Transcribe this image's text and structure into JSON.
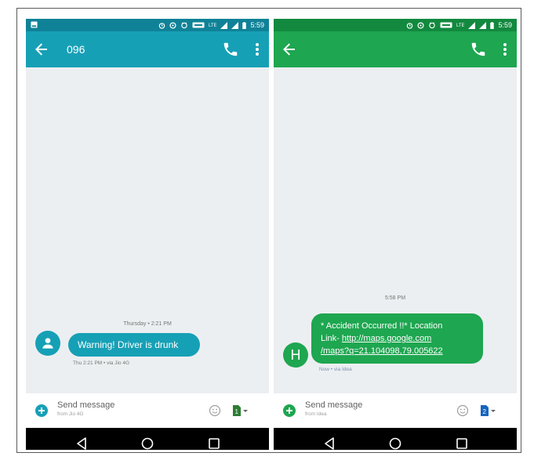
{
  "colors": {
    "teal_status": "#0f8297",
    "teal_appbar": "#16a0b6",
    "green_status": "#12893f",
    "green_appbar": "#1ea650",
    "chat_background": "#eceff1",
    "navbar": "#000000"
  },
  "left_phone": {
    "status_bar": {
      "time": "5:59",
      "icons": [
        "notification-icon",
        "alarm-icon",
        "data-saver-icon",
        "hd-icon",
        "lte-icon",
        "signal-icon",
        "signal-icon",
        "battery-icon"
      ]
    },
    "app_bar": {
      "title": "096",
      "back_icon": "arrow-left-icon",
      "call_icon": "phone-icon",
      "menu_icon": "more-vert-icon"
    },
    "thread": {
      "timestamp": "Thursday • 2:21 PM",
      "avatar_icon": "person-icon",
      "message": "Warning! Driver is drunk",
      "meta": "Thu 2:21 PM • via Jio 4G"
    },
    "composer": {
      "placeholder": "Send message",
      "sub_label": "from Jio 4G",
      "add_icon": "add-circle-icon",
      "emoji_icon": "emoji-icon",
      "sim_icon": "sim-card-icon"
    },
    "nav": {
      "back_icon": "nav-back-icon",
      "home_icon": "nav-home-icon",
      "recent_icon": "nav-recent-icon"
    }
  },
  "right_phone": {
    "status_bar": {
      "time": "5:59",
      "icons": [
        "alarm-icon",
        "data-saver-icon",
        "hd-icon",
        "lte-icon",
        "signal-icon",
        "signal-icon",
        "battery-icon"
      ]
    },
    "app_bar": {
      "title": "",
      "back_icon": "arrow-left-icon",
      "call_icon": "phone-icon",
      "menu_icon": "more-vert-icon"
    },
    "thread": {
      "timestamp": "5:58 PM",
      "avatar_letter": "H",
      "message_line1": "* Accident Occurred !!* Location",
      "message_line2_prefix": "Link- ",
      "message_link_part1": "http://maps.google.com",
      "message_link_part2": "/maps?q=21.104098,79.005622",
      "meta": "Now • via Idea"
    },
    "composer": {
      "placeholder": "Send message",
      "sub_label": "from Idea",
      "add_icon": "add-circle-icon",
      "emoji_icon": "emoji-icon",
      "sim_icon": "sim-card-icon"
    },
    "nav": {
      "back_icon": "nav-back-icon",
      "home_icon": "nav-home-icon",
      "recent_icon": "nav-recent-icon"
    }
  }
}
